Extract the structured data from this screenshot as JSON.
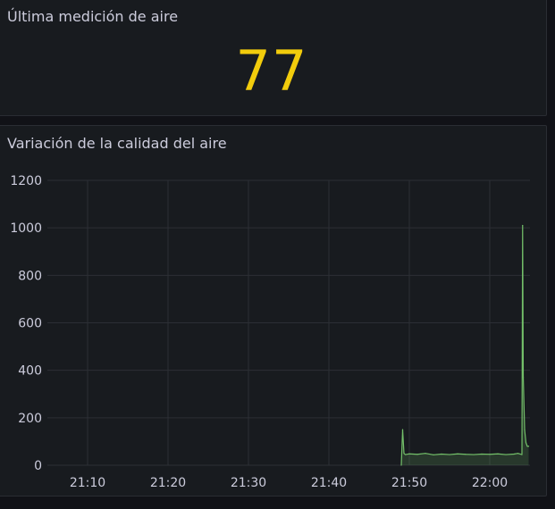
{
  "stat_panel": {
    "title": "Última medición de aire",
    "value": "77",
    "value_color": "#f2cc0c"
  },
  "timeseries_panel": {
    "title": "Variación de la calidad del aire",
    "line_color": "#73bf69"
  },
  "chart_data": {
    "type": "line",
    "title": "Variación de la calidad del aire",
    "xlabel": "",
    "ylabel": "",
    "ylim": [
      0,
      1200
    ],
    "y_ticks": [
      "0",
      "200",
      "400",
      "600",
      "800",
      "1000",
      "1200"
    ],
    "x_ticks": [
      "21:10",
      "21:20",
      "21:30",
      "21:40",
      "21:50",
      "22:00"
    ],
    "xlim": [
      "21:05",
      "22:05"
    ],
    "grid": true,
    "fill_below": true,
    "series": [
      {
        "values_note": "",
        "x": [
          "21:49:00",
          "21:49:10",
          "21:49:20",
          "21:49:30",
          "21:50:00",
          "21:51:00",
          "21:52:00",
          "21:53:00",
          "21:54:00",
          "21:55:00",
          "21:56:00",
          "21:57:00",
          "21:58:00",
          "21:59:00",
          "22:00:00",
          "22:01:00",
          "22:02:00",
          "22:03:00",
          "22:03:30",
          "22:04:00",
          "22:04:05",
          "22:04:10",
          "22:04:20",
          "22:04:30",
          "22:04:40",
          "22:04:50"
        ],
        "y": [
          0,
          150,
          50,
          45,
          48,
          46,
          50,
          44,
          47,
          45,
          48,
          46,
          45,
          47,
          46,
          48,
          45,
          47,
          50,
          45,
          1010,
          370,
          150,
          95,
          80,
          80
        ]
      }
    ]
  }
}
